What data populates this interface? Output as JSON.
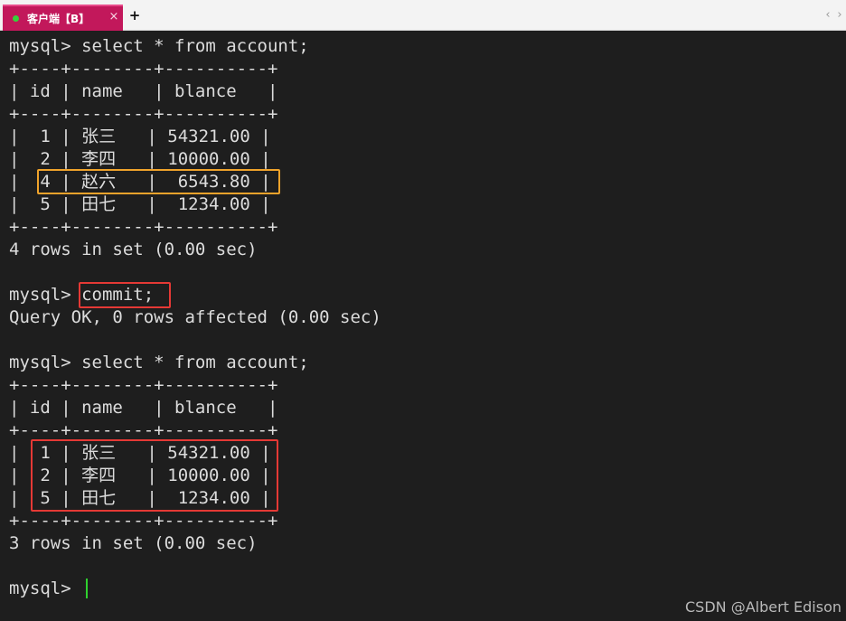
{
  "tab": {
    "title": "客户端【B】",
    "close": "×",
    "add": "+"
  },
  "nav": {
    "left": "‹",
    "right": "›"
  },
  "terminal": {
    "lines": [
      "mysql> select * from account;",
      "+----+--------+----------+",
      "| id | name   | blance   |",
      "+----+--------+----------+",
      "|  1 | 张三   | 54321.00 |",
      "|  2 | 李四   | 10000.00 |",
      "|  4 | 赵六   |  6543.80 |",
      "|  5 | 田七   |  1234.00 |",
      "+----+--------+----------+",
      "4 rows in set (0.00 sec)",
      "",
      "mysql> commit;",
      "Query OK, 0 rows affected (0.00 sec)",
      "",
      "mysql> select * from account;",
      "+----+--------+----------+",
      "| id | name   | blance   |",
      "+----+--------+----------+",
      "|  1 | 张三   | 54321.00 |",
      "|  2 | 李四   | 10000.00 |",
      "|  5 | 田七   |  1234.00 |",
      "+----+--------+----------+",
      "3 rows in set (0.00 sec)",
      "",
      "mysql> "
    ]
  },
  "watermark": "CSDN @Albert Edison",
  "colors": {
    "tab_bg": "#c2185b",
    "terminal_bg": "#1e1e1e",
    "text": "#dcdcdc",
    "cursor": "#2fd12f",
    "highlight_orange": "#f0a32b",
    "highlight_red": "#e53935"
  }
}
